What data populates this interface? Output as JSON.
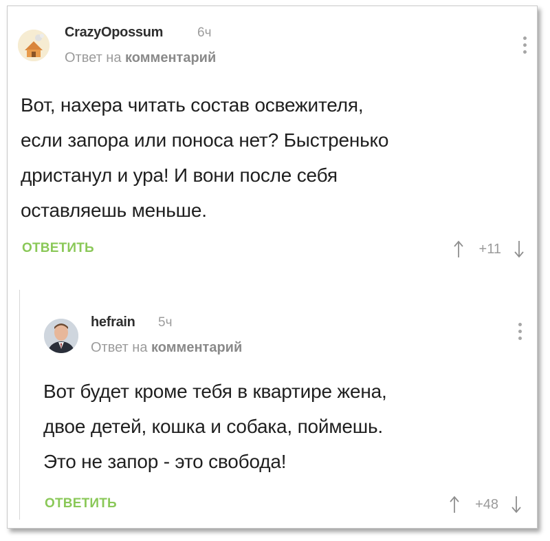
{
  "comments": [
    {
      "author": "CrazyOpossum",
      "time": "6ч",
      "reply_to_prefix": "Ответ на",
      "reply_to_link": "комментарий",
      "text_lines": [
        "Вот, нахера читать состав освежителя,",
        "если запора или поноса нет? Быстренько",
        "дристанул и ура! И вони после себя",
        "оставляешь меньше."
      ],
      "reply_label": "ОТВЕТИТЬ",
      "score": "+11"
    },
    {
      "author": "hefrain",
      "time": "5ч",
      "reply_to_prefix": "Ответ на",
      "reply_to_link": "комментарий",
      "text_lines": [
        "Вот будет кроме тебя в квартире жена,",
        "двое детей, кошка и собака, поймешь.",
        "Это не запор - это свобода!"
      ],
      "reply_label": "ОТВЕТИТЬ",
      "score": "+48"
    }
  ],
  "icons": {
    "menu": "more-vertical-icon",
    "upvote": "arrow-up-icon",
    "downvote": "arrow-down-icon"
  },
  "colors": {
    "accent_green": "#8ac858",
    "text": "#1f1f1f",
    "muted": "#9a9a9a"
  }
}
